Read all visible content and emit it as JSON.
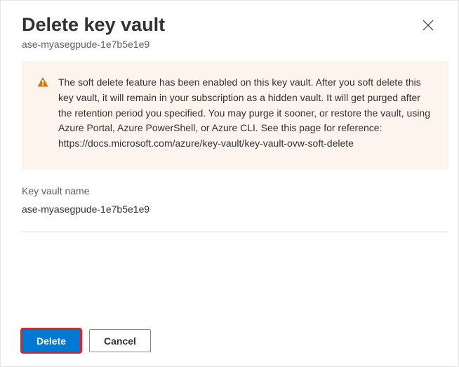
{
  "header": {
    "title": "Delete key vault",
    "subtitle": "ase-myasegpude-1e7b5e1e9"
  },
  "warning": {
    "text": "The soft delete feature has been enabled on this key vault. After you soft delete this key vault, it will remain in your subscription as a hidden vault. It will get purged after the retention period you specified. You may purge it sooner, or restore the vault, using Azure Portal, Azure PowerShell, or Azure CLI. See this page for reference: https://docs.microsoft.com/azure/key-vault/key-vault-ovw-soft-delete"
  },
  "field": {
    "label": "Key vault name",
    "value": "ase-myasegpude-1e7b5e1e9"
  },
  "footer": {
    "delete_label": "Delete",
    "cancel_label": "Cancel"
  }
}
